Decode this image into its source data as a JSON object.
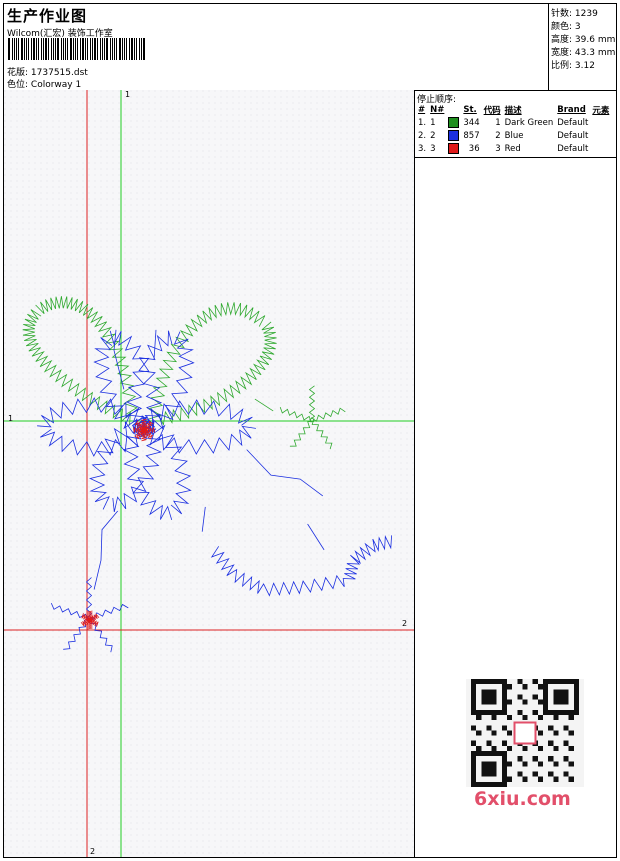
{
  "header": {
    "title": "生产作业图",
    "subtitle": "Wilcom(汇宏) 装饰工作室",
    "design_label": "花版:",
    "design_value": "1737515.dst",
    "colorway_label": "色位:",
    "colorway_value": "Colorway 1"
  },
  "stats": [
    {
      "label": "针数:",
      "value": "1239"
    },
    {
      "label": "颜色:",
      "value": "3"
    },
    {
      "label": "高度:",
      "value": "39.6 mm"
    },
    {
      "label": "宽度:",
      "value": "43.3 mm"
    },
    {
      "label": "比例:",
      "value": "3.12"
    }
  ],
  "stop_sequence": {
    "title": "停止顺序:",
    "columns": [
      "#",
      "N#",
      "St.",
      "代码",
      "描述",
      "Brand",
      "元素"
    ],
    "rows": [
      {
        "num": "1.",
        "n": "1",
        "color": "#1f8f1f",
        "st": "344",
        "code": "1",
        "desc": "Dark Green",
        "brand": "Default"
      },
      {
        "num": "2.",
        "n": "2",
        "color": "#1b2fe0",
        "st": "857",
        "code": "2",
        "desc": "Blue",
        "brand": "Default"
      },
      {
        "num": "3.",
        "n": "3",
        "color": "#e01b1b",
        "st": "36",
        "code": "3",
        "desc": "Red",
        "brand": "Default"
      }
    ]
  },
  "axes": {
    "green_v_label": "1",
    "green_h_label": "1",
    "red_h_label": "2",
    "red_v_label": "2"
  },
  "watermark": "6xiu.com",
  "colors": {
    "green": "#2ea82e",
    "blue": "#1b2fe0",
    "red": "#e01b1b"
  }
}
